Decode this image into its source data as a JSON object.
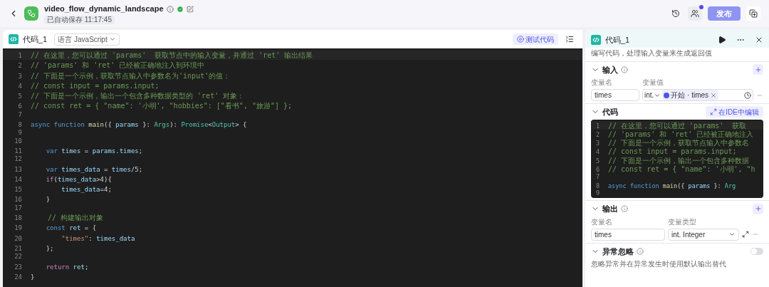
{
  "app": {
    "title": "video_flow_dynamic_landscape",
    "autosave": "已自动保存 11:17:45",
    "publish_button": "发布"
  },
  "editor": {
    "title": "代码_1",
    "language_select": "语言 JavaScript",
    "test_button": "测试代码",
    "lines": [
      {
        "no": "1",
        "tokens": [
          {
            "kind": "comment",
            "text": "// 在这里，您可以通过 'params'  获取节点中的输入变量，并通过 'ret' 输出结果"
          }
        ]
      },
      {
        "no": "2",
        "tokens": [
          {
            "kind": "comment",
            "text": "// 'params' 和 'ret' 已经被正确地注入到环境中"
          }
        ]
      },
      {
        "no": "3",
        "tokens": [
          {
            "kind": "comment",
            "text": "// 下面是一个示例，获取节点输入中参数名为'input'的值："
          }
        ]
      },
      {
        "no": "4",
        "tokens": [
          {
            "kind": "comment",
            "text": "// const input = params.input;"
          }
        ]
      },
      {
        "no": "5",
        "tokens": [
          {
            "kind": "comment",
            "text": "// 下面是一个示例，输出一个包含多种数据类型的 'ret' 对象："
          }
        ]
      },
      {
        "no": "6",
        "tokens": [
          {
            "kind": "comment",
            "text": "// const ret = { \"name\": '小明', \"hobbies\": [\"看书\", \"旅游\"] };"
          }
        ]
      },
      {
        "no": "7"
      },
      {
        "no": "8",
        "tokens": [
          {
            "kind": "keyword",
            "text": "async function "
          },
          {
            "kind": "function",
            "text": "main"
          },
          {
            "kind": "plain",
            "text": "({ "
          },
          {
            "kind": "variable",
            "text": "params"
          },
          {
            "kind": "plain",
            "text": " }: "
          },
          {
            "kind": "type",
            "text": "Args"
          },
          {
            "kind": "plain",
            "text": "): "
          },
          {
            "kind": "type",
            "text": "Promise"
          },
          {
            "kind": "plain",
            "text": "<"
          },
          {
            "kind": "type",
            "text": "Output"
          },
          {
            "kind": "plain",
            "text": "> {"
          }
        ]
      },
      {
        "no": "9"
      },
      {
        "no": "10"
      },
      {
        "no": "11",
        "tokens": [
          {
            "kind": "keyword",
            "text": "    var "
          },
          {
            "kind": "variable",
            "text": "times"
          },
          {
            "kind": "plain",
            "text": " = "
          },
          {
            "kind": "variable",
            "text": "params.times"
          },
          {
            "kind": "plain",
            "text": ";"
          }
        ]
      },
      {
        "no": "12"
      },
      {
        "no": "13",
        "tokens": [
          {
            "kind": "keyword",
            "text": "    var "
          },
          {
            "kind": "variable",
            "text": "times_data"
          },
          {
            "kind": "plain",
            "text": " = "
          },
          {
            "kind": "variable",
            "text": "times"
          },
          {
            "kind": "plain",
            "text": "/5;"
          }
        ]
      },
      {
        "no": "14",
        "tokens": [
          {
            "kind": "control",
            "text": "    if"
          },
          {
            "kind": "plain",
            "text": "("
          },
          {
            "kind": "variable",
            "text": "times_data"
          },
          {
            "kind": "plain",
            "text": ">4){"
          }
        ]
      },
      {
        "no": "15",
        "tokens": [
          {
            "kind": "variable",
            "text": "        times_data"
          },
          {
            "kind": "plain",
            "text": "=4;"
          }
        ]
      },
      {
        "no": "16",
        "tokens": [
          {
            "kind": "plain",
            "text": "    }"
          }
        ]
      },
      {
        "no": "17"
      },
      {
        "no": "18",
        "tokens": [
          {
            "kind": "comment",
            "text": "    // 构建输出对象"
          }
        ]
      },
      {
        "no": "19",
        "tokens": [
          {
            "kind": "keyword",
            "text": "    const "
          },
          {
            "kind": "variable",
            "text": "ret"
          },
          {
            "kind": "plain",
            "text": " = {"
          }
        ]
      },
      {
        "no": "20",
        "tokens": [
          {
            "kind": "string",
            "text": "        \"times\""
          },
          {
            "kind": "plain",
            "text": ": "
          },
          {
            "kind": "variable",
            "text": "times_data"
          }
        ]
      },
      {
        "no": "21",
        "tokens": [
          {
            "kind": "plain",
            "text": "    };"
          }
        ]
      },
      {
        "no": "22"
      },
      {
        "no": "23",
        "tokens": [
          {
            "kind": "control",
            "text": "    return "
          },
          {
            "kind": "variable",
            "text": "ret"
          },
          {
            "kind": "plain",
            "text": ";"
          }
        ]
      },
      {
        "no": "24",
        "tokens": [
          {
            "kind": "plain",
            "text": "}"
          }
        ]
      }
    ]
  },
  "panel": {
    "title": "代码_1",
    "description": "编写代码，处理输入变量来生成返回值",
    "input": {
      "title": "输入",
      "columns": [
        "变量名",
        "变量值"
      ],
      "rows": [
        {
          "name": "times",
          "type": "int.",
          "tag": "开始 · times"
        }
      ]
    },
    "code": {
      "title": "代码",
      "ide_button": "在IDE中编辑",
      "lines": [
        {
          "no": "1",
          "tokens": [
            {
              "kind": "comment",
              "text": "// 在这里，您可以通过 'params'  获取"
            }
          ]
        },
        {
          "no": "2",
          "tokens": [
            {
              "kind": "comment",
              "text": "// 'params' 和 'ret' 已经被正确地注入"
            }
          ]
        },
        {
          "no": "3",
          "tokens": [
            {
              "kind": "comment",
              "text": "// 下面是一个示例，获取节点输入中参数名"
            }
          ]
        },
        {
          "no": "4",
          "tokens": [
            {
              "kind": "comment",
              "text": "// const input = params.input;"
            }
          ]
        },
        {
          "no": "5",
          "tokens": [
            {
              "kind": "comment",
              "text": "// 下面是一个示例，输出一个包含多种数据"
            }
          ]
        },
        {
          "no": "6",
          "tokens": [
            {
              "kind": "comment",
              "text": "// const ret = { \"name\": '小明', \"h"
            }
          ]
        },
        {
          "no": "7"
        },
        {
          "no": "8",
          "tokens": [
            {
              "kind": "keyword",
              "text": "async function "
            },
            {
              "kind": "function",
              "text": "main"
            },
            {
              "kind": "plain",
              "text": "({ "
            },
            {
              "kind": "variable",
              "text": "params"
            },
            {
              "kind": "plain",
              "text": " }: "
            },
            {
              "kind": "type",
              "text": "Arg"
            }
          ]
        },
        {
          "no": "9"
        }
      ]
    },
    "output": {
      "title": "输出",
      "columns": [
        "变量名",
        "变量类型"
      ],
      "rows": [
        {
          "name": "times",
          "type": "int. Integer"
        }
      ]
    },
    "exception": {
      "title": "异常忽略",
      "on": false,
      "description": "忽略异常并在异常发生时使用默认输出替代"
    }
  }
}
